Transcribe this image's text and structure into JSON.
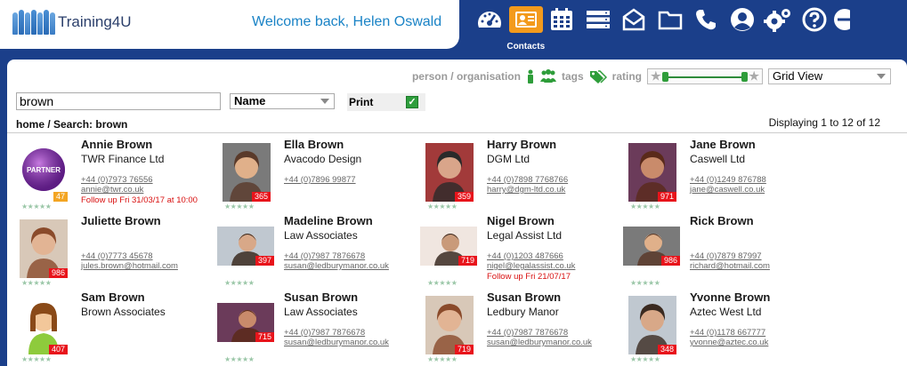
{
  "brand": {
    "name": "Training4U"
  },
  "header": {
    "welcome": "Welcome back, Helen Oswald"
  },
  "nav": [
    {
      "name": "dashboard-icon",
      "label": ""
    },
    {
      "name": "contacts-icon",
      "label": "Contacts",
      "active": true
    },
    {
      "name": "calendar-icon",
      "label": ""
    },
    {
      "name": "list-icon",
      "label": ""
    },
    {
      "name": "mail-icon",
      "label": ""
    },
    {
      "name": "folder-icon",
      "label": ""
    },
    {
      "name": "phone-icon",
      "label": ""
    },
    {
      "name": "user-icon",
      "label": ""
    },
    {
      "name": "settings-icon",
      "label": ""
    },
    {
      "name": "help-icon",
      "label": ""
    },
    {
      "name": "more-icon",
      "label": ""
    }
  ],
  "filters": {
    "person_org": "person / organisation",
    "tags": "tags",
    "rating": "rating",
    "view": "Grid View"
  },
  "search": {
    "value": "brown"
  },
  "sort": {
    "value": "Name"
  },
  "print": {
    "label": "Print",
    "checked": true
  },
  "breadcrumb": "home / Search: brown",
  "display_count": "Displaying 1 to 12 of 12",
  "colors": {
    "header_bg": "#1b3f8a",
    "active_tab": "#f39a1c",
    "badge": "#e8141b",
    "follow_up": "#d81010"
  },
  "contacts": [
    {
      "name": "Annie Brown",
      "company": "TWR Finance Ltd",
      "phone": "+44 (0)7973 76556",
      "email": "annie@twr.co.uk",
      "follow": "Follow up Fri 31/03/17 at 10:00",
      "badge": "47",
      "avatar": "partner"
    },
    {
      "name": "Ella Brown",
      "company": "Avacodo Design",
      "phone": "+44 (0)7896 99877",
      "email": "",
      "follow": "",
      "badge": "365",
      "avatar": "photo"
    },
    {
      "name": "Harry Brown",
      "company": "DGM Ltd",
      "phone": "+44 (0)7898 7768766",
      "email": "harry@dgm-ltd.co.uk",
      "follow": "",
      "badge": "359",
      "avatar": "photo"
    },
    {
      "name": "Jane Brown",
      "company": "Caswell Ltd",
      "phone": "+44 (0)1249 876788",
      "email": "jane@caswell.co.uk",
      "follow": "",
      "badge": "971",
      "avatar": "photo"
    },
    {
      "name": "Juliette Brown",
      "company": "",
      "phone": "+44 (0)7773 45678",
      "email": "jules.brown@hotmail.com",
      "follow": "",
      "badge": "986",
      "avatar": "photo"
    },
    {
      "name": "Madeline Brown",
      "company": "Law Associates",
      "phone": "+44 (0)7987 7876678",
      "email": "susan@ledburymanor.co.uk",
      "follow": "",
      "badge": "397",
      "avatar": "wide"
    },
    {
      "name": "Nigel Brown",
      "company": "Legal Assist Ltd",
      "phone": "+44 (0)1203 487666",
      "email": "nigel@legalassist.co.uk",
      "follow": "Follow up Fri 21/07/17",
      "badge": "719",
      "avatar": "wide"
    },
    {
      "name": "Rick Brown",
      "company": "",
      "phone": "+44 (0)7879 87997",
      "email": "richard@hotmail.com",
      "follow": "",
      "badge": "986",
      "avatar": "wide"
    },
    {
      "name": "Sam Brown",
      "company": "Brown Associates",
      "phone": "",
      "email": "",
      "follow": "",
      "badge": "407",
      "avatar": "cartoon"
    },
    {
      "name": "Susan Brown",
      "company": "Law Associates",
      "phone": "+44 (0)7987 7876678",
      "email": "susan@ledburymanor.co.uk",
      "follow": "",
      "badge": "715",
      "avatar": "wide"
    },
    {
      "name": "Susan Brown",
      "company": "Ledbury Manor",
      "phone": "+44 (0)7987 7876678",
      "email": "susan@ledburymanor.co.uk",
      "follow": "",
      "badge": "719",
      "avatar": "photo"
    },
    {
      "name": "Yvonne Brown",
      "company": "Aztec West Ltd",
      "phone": "+44 (0)1178 667777",
      "email": "yvonne@aztec.co.uk",
      "follow": "",
      "badge": "348",
      "avatar": "photo"
    }
  ]
}
